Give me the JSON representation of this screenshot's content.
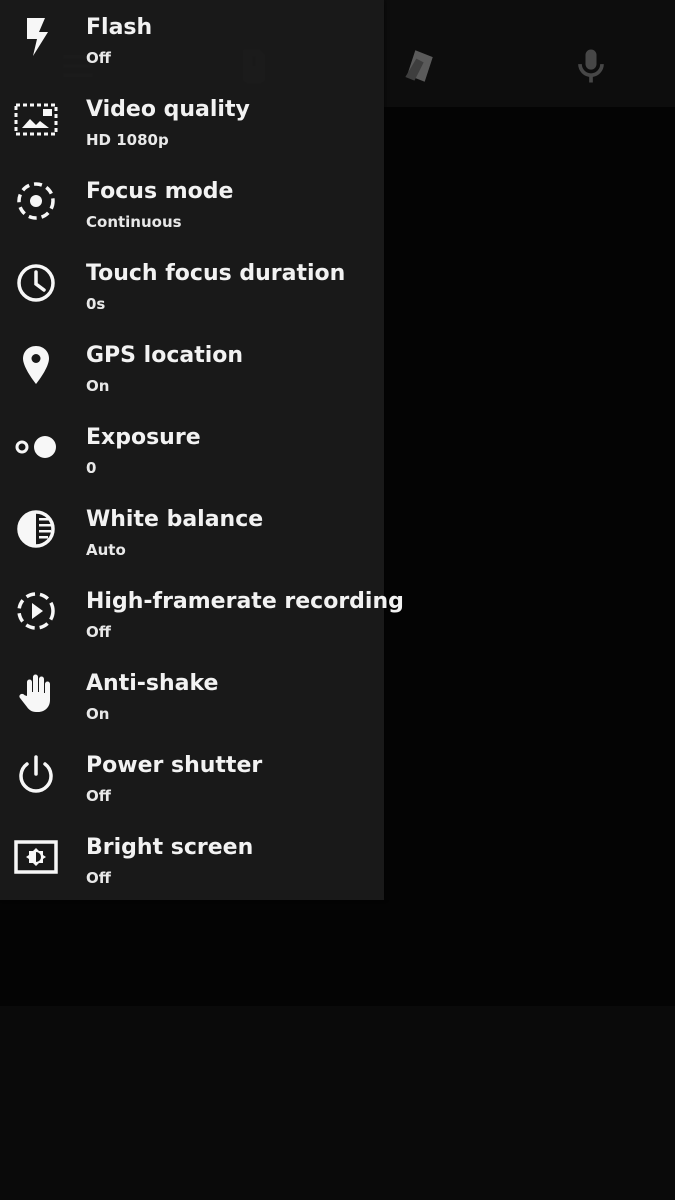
{
  "colors": {
    "panel_bg": "#1a1a1a",
    "text_primary": "#fafafa",
    "text_secondary": "#f0f0f0",
    "background": "#000000"
  },
  "top_bar": {
    "icons": [
      "menu-icon",
      "sd-card-icon",
      "scene-cards-icon",
      "microphone-icon"
    ]
  },
  "settings": [
    {
      "title": "Flash",
      "value": "Off",
      "icon": "flash-icon"
    },
    {
      "title": "Video quality",
      "value": "HD 1080p",
      "icon": "video-quality-icon"
    },
    {
      "title": "Focus mode",
      "value": "Continuous",
      "icon": "focus-mode-icon"
    },
    {
      "title": "Touch focus duration",
      "value": "0s",
      "icon": "clock-icon"
    },
    {
      "title": "GPS location",
      "value": "On",
      "icon": "location-pin-icon"
    },
    {
      "title": "Exposure",
      "value": "0",
      "icon": "exposure-icon"
    },
    {
      "title": "White balance",
      "value": "Auto",
      "icon": "white-balance-icon"
    },
    {
      "title": "High-framerate recording",
      "value": "Off",
      "icon": "high-framerate-icon"
    },
    {
      "title": "Anti-shake",
      "value": "On",
      "icon": "hand-icon"
    },
    {
      "title": "Power shutter",
      "value": "Off",
      "icon": "power-icon"
    },
    {
      "title": "Bright screen",
      "value": "Off",
      "icon": "bright-screen-icon"
    }
  ]
}
